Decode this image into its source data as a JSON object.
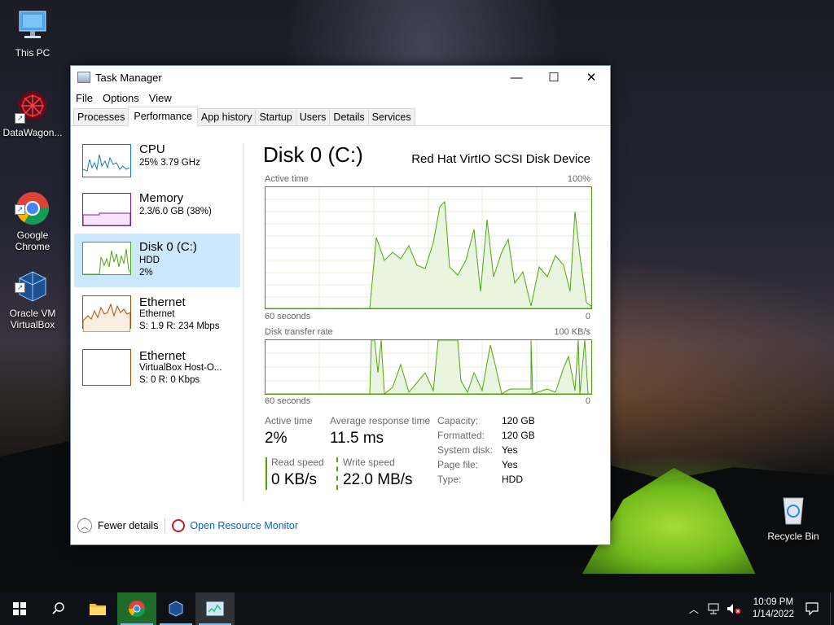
{
  "desktop": {
    "icons": [
      {
        "label": "This PC"
      },
      {
        "label": "DataWagon..."
      },
      {
        "label": "Google\nChrome"
      },
      {
        "label": "Oracle VM\nVirtualBox"
      },
      {
        "label": "Recycle Bin"
      }
    ]
  },
  "window": {
    "title": "Task Manager",
    "controls": {
      "minimize": "—",
      "maximize": "☐",
      "close": "✕"
    },
    "menu": [
      "File",
      "Options",
      "View"
    ],
    "tabs": [
      "Processes",
      "Performance",
      "App history",
      "Startup",
      "Users",
      "Details",
      "Services"
    ],
    "active_tab": "Performance"
  },
  "resources": [
    {
      "name": "CPU",
      "line1": "25%  3.79 GHz",
      "line2": "",
      "color": "#117dbb"
    },
    {
      "name": "Memory",
      "line1": "2.3/6.0 GB (38%)",
      "line2": "",
      "color": "#8b12ae"
    },
    {
      "name": "Disk 0 (C:)",
      "line1": "HDD",
      "line2": "2%",
      "color": "#4da60c"
    },
    {
      "name": "Ethernet",
      "line1": "Ethernet",
      "line2": "S: 1.9  R: 234 Mbps",
      "color": "#a74f01"
    },
    {
      "name": "Ethernet",
      "line1": "VirtualBox Host-O...",
      "line2": "S: 0  R: 0 Kbps",
      "color": "#a74f01"
    }
  ],
  "detail": {
    "title": "Disk 0 (C:)",
    "model": "Red Hat VirtIO SCSI Disk Device",
    "graph1": {
      "label": "Active time",
      "max": "100%",
      "time": "60 seconds",
      "min": "0"
    },
    "graph2": {
      "label": "Disk transfer rate",
      "max": "100 KB/s",
      "time": "60 seconds",
      "min": "0"
    },
    "stats": {
      "active_time_label": "Active time",
      "active_time": "2%",
      "avg_resp_label": "Average response time",
      "avg_resp": "11.5 ms",
      "read_label": "Read speed",
      "read": "0 KB/s",
      "write_label": "Write speed",
      "write": "22.0 MB/s"
    },
    "properties": [
      {
        "k": "Capacity:",
        "v": "120 GB"
      },
      {
        "k": "Formatted:",
        "v": "120 GB"
      },
      {
        "k": "System disk:",
        "v": "Yes"
      },
      {
        "k": "Page file:",
        "v": "Yes"
      },
      {
        "k": "Type:",
        "v": "HDD"
      }
    ]
  },
  "footer": {
    "fewer": "Fewer details",
    "monitor": "Open Resource Monitor"
  },
  "taskbar": {
    "time": "10:09 PM",
    "date": "1/14/2022"
  },
  "colors": {
    "disk_green": "#4da60c",
    "selected_bg": "#cce8ff",
    "link": "#0066cc"
  }
}
